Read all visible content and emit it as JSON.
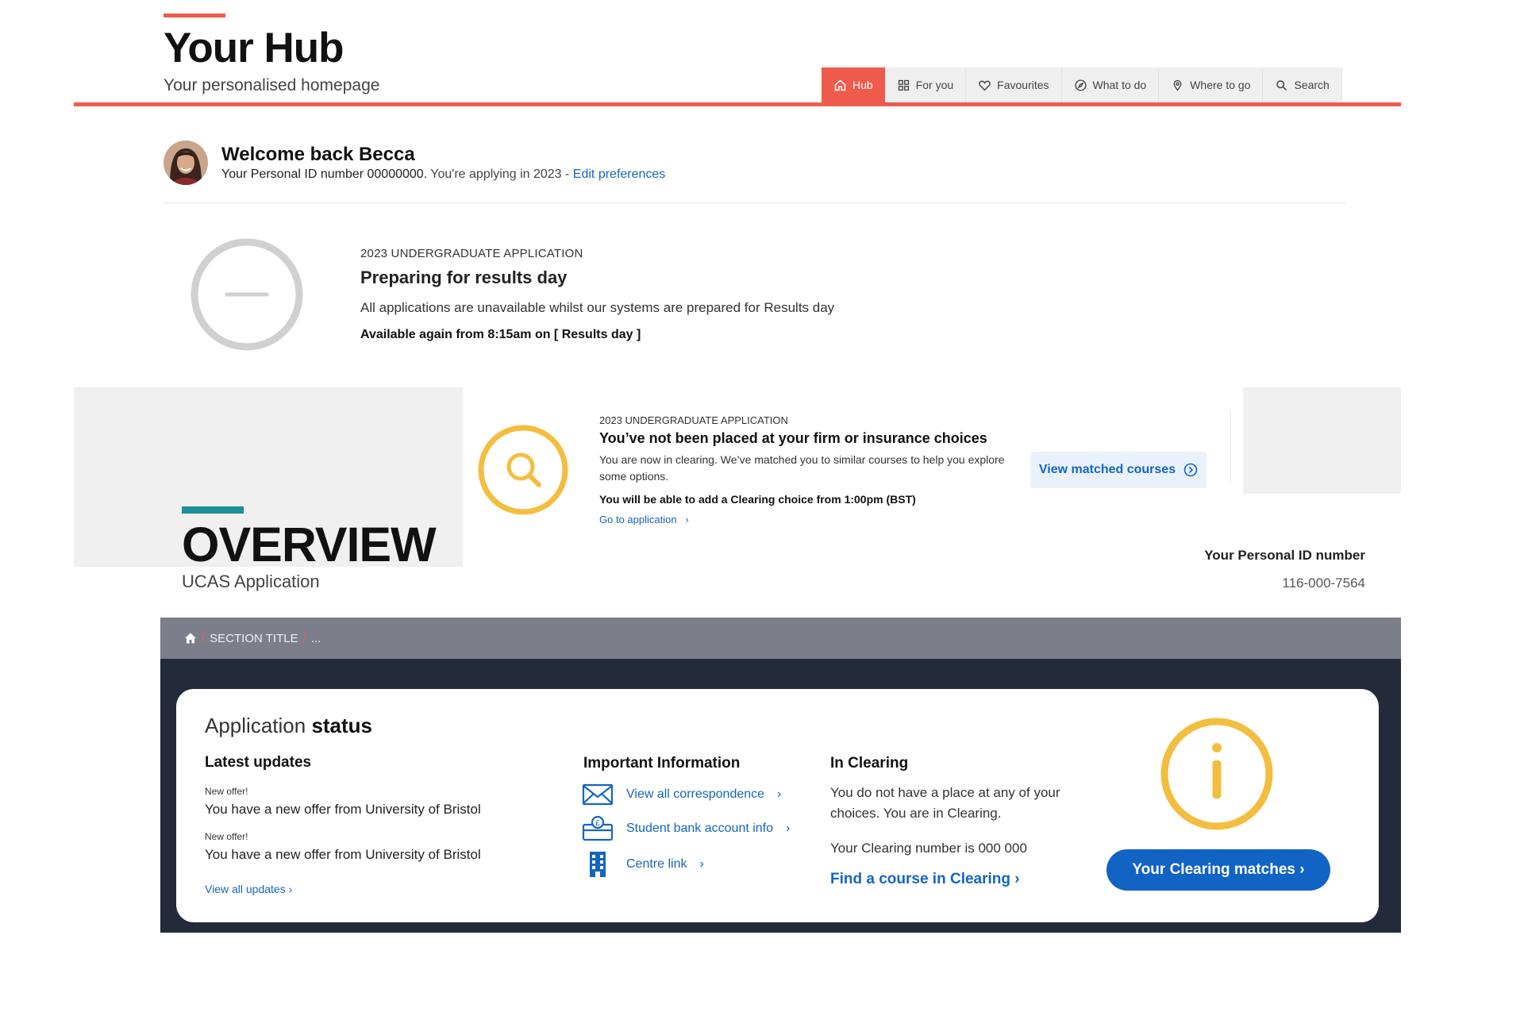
{
  "hub": {
    "title": "Your Hub",
    "subtitle": "Your personalised homepage",
    "nav": [
      {
        "label": "Hub",
        "icon": "home-icon"
      },
      {
        "label": "For you",
        "icon": "grid-icon"
      },
      {
        "label": "Favourites",
        "icon": "heart-icon"
      },
      {
        "label": "What to do",
        "icon": "compass-icon"
      },
      {
        "label": "Where to go",
        "icon": "location-pin-icon"
      },
      {
        "label": "Search",
        "icon": "search-icon"
      }
    ],
    "active_tab": "Hub",
    "accent_color": "#ef5b4c"
  },
  "welcome": {
    "title": "Welcome back Becca",
    "id_text": "Your Personal ID number 00000000.",
    "applying_text": "You're applying in 2023 -",
    "edit_link": "Edit preferences"
  },
  "status_1": {
    "kicker": "2023 UNDERGRADUATE APPLICATION",
    "title": "Preparing for results day",
    "body": "All applications are unavailable whilst our systems are prepared for Results day",
    "note": "Available again from 8:15am on [ Results day ]"
  },
  "clearing_card": {
    "kicker": "2023 UNDERGRADUATE APPLICATION",
    "title": "You’ve not been placed at your firm or insurance choices",
    "body": "You are now in clearing.  We’ve matched you to similar courses to help you explore some options.",
    "note": "You will be able to add a Clearing choice from 1:00pm (BST)",
    "link": "Go to application",
    "button": "View matched courses",
    "icon_color": "#f3be3f"
  },
  "overview": {
    "title": "OVERVIEW",
    "subtitle": "UCAS Application",
    "pid_label": "Your Personal ID number",
    "pid_value": "116-000-7564",
    "accent_color": "#1a8f99"
  },
  "breadcrumb": {
    "section": "SECTION TITLE",
    "separator": "/",
    "ellipsis": "..."
  },
  "application_status": {
    "title_light": "Application",
    "title_bold": "status",
    "latest_updates": {
      "title": "Latest updates",
      "items": [
        {
          "label": "New offer!",
          "text": "You have a new offer from University of Bristol"
        },
        {
          "label": "New offer!",
          "text": "You have a new offer from University of Bristol"
        }
      ],
      "link": "View all updates"
    },
    "important_info": {
      "title": "Important Information",
      "items": [
        {
          "label": "View all correspondence",
          "icon": "envelope-icon"
        },
        {
          "label": "Student bank account info",
          "icon": "bank-card-icon"
        },
        {
          "label": "Centre link",
          "icon": "building-icon"
        }
      ]
    },
    "in_clearing": {
      "title": "In Clearing",
      "body": "You do not have a place at any of your choices. You are in Clearing.",
      "number_text": "Your Clearing number is 000 000",
      "link": "Find a course in Clearing"
    },
    "button": "Your Clearing matches",
    "button_color": "#1163c4"
  }
}
